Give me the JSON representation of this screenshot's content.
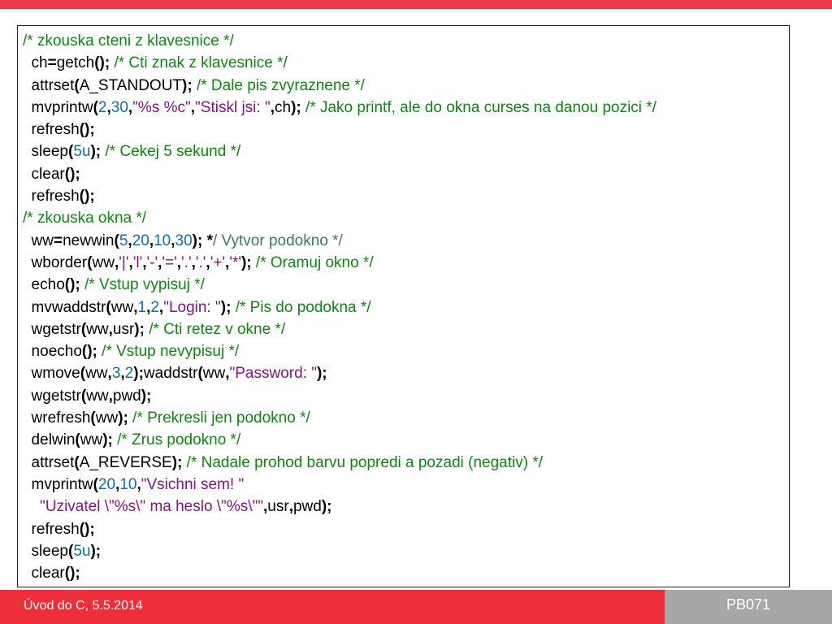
{
  "slide": {
    "footer_left": "Úvod do C, 5.5.2014",
    "footer_right": "PB071"
  },
  "code_lines": [
    [
      [
        "cm",
        "/* zkouska cteni z klavesnice */"
      ]
    ],
    [
      [
        "tx",
        "  ch"
      ],
      [
        "kw",
        "="
      ],
      [
        "tx",
        "getch"
      ],
      [
        "kw",
        "();"
      ],
      [
        "tx",
        " "
      ],
      [
        "cm",
        "/* Cti znak z klavesnice */"
      ]
    ],
    [
      [
        "tx",
        "  attrset"
      ],
      [
        "kw",
        "("
      ],
      [
        "tx",
        "A_STANDOUT"
      ],
      [
        "kw",
        ");"
      ],
      [
        "tx",
        " "
      ],
      [
        "cm",
        "/* Dale pis zvyraznene */"
      ]
    ],
    [
      [
        "tx",
        "  mvprintw"
      ],
      [
        "kw",
        "("
      ],
      [
        "nm",
        "2"
      ],
      [
        "kw",
        ","
      ],
      [
        "nm",
        "30"
      ],
      [
        "kw",
        ","
      ],
      [
        "st",
        "\"%s %c\""
      ],
      [
        "kw",
        ","
      ],
      [
        "st",
        "\"Stiskl jsi: \""
      ],
      [
        "kw",
        ","
      ],
      [
        "tx",
        "ch"
      ],
      [
        "kw",
        ");"
      ],
      [
        "tx",
        " "
      ],
      [
        "cm",
        "/* Jako printf, ale do okna curses na danou pozici */"
      ]
    ],
    [
      [
        "tx",
        "  refresh"
      ],
      [
        "kw",
        "();"
      ]
    ],
    [
      [
        "tx",
        "  sleep"
      ],
      [
        "kw",
        "("
      ],
      [
        "nm",
        "5u"
      ],
      [
        "kw",
        ");"
      ],
      [
        "tx",
        " "
      ],
      [
        "cm",
        "/* Cekej 5 sekund */"
      ]
    ],
    [
      [
        "tx",
        "  clear"
      ],
      [
        "kw",
        "();"
      ]
    ],
    [
      [
        "tx",
        "  refresh"
      ],
      [
        "kw",
        "();"
      ]
    ],
    [
      [
        "cm",
        "/* zkouska okna */"
      ]
    ],
    [
      [
        "tx",
        "  ww"
      ],
      [
        "kw",
        "="
      ],
      [
        "tx",
        "newwin"
      ],
      [
        "kw",
        "("
      ],
      [
        "nm",
        "5"
      ],
      [
        "kw",
        ","
      ],
      [
        "nm",
        "20"
      ],
      [
        "kw",
        ","
      ],
      [
        "nm",
        "10"
      ],
      [
        "kw",
        ","
      ],
      [
        "nm",
        "30"
      ],
      [
        "kw",
        ");"
      ],
      [
        "tx",
        " "
      ],
      [
        "kw",
        "*"
      ],
      [
        "cmg",
        "/ Vytvor podokno */"
      ]
    ],
    [
      [
        "tx",
        "  wborder"
      ],
      [
        "kw",
        "("
      ],
      [
        "tx",
        "ww"
      ],
      [
        "kw",
        ","
      ],
      [
        "st",
        "'|'"
      ],
      [
        "kw",
        ","
      ],
      [
        "st",
        "'l'"
      ],
      [
        "kw",
        ","
      ],
      [
        "st",
        "'-'"
      ],
      [
        "kw",
        ","
      ],
      [
        "st",
        "'='"
      ],
      [
        "kw",
        ","
      ],
      [
        "st",
        "'.'"
      ],
      [
        "kw",
        ","
      ],
      [
        "st",
        "'.'"
      ],
      [
        "kw",
        ","
      ],
      [
        "st",
        "'+'"
      ],
      [
        "kw",
        ","
      ],
      [
        "st",
        "'*'"
      ],
      [
        "kw",
        ");"
      ],
      [
        "tx",
        " "
      ],
      [
        "cm",
        "/* Oramuj okno */"
      ]
    ],
    [
      [
        "tx",
        "  echo"
      ],
      [
        "kw",
        "();"
      ],
      [
        "tx",
        " "
      ],
      [
        "cm",
        "/* Vstup vypisuj */"
      ]
    ],
    [
      [
        "tx",
        "  mvwaddstr"
      ],
      [
        "kw",
        "("
      ],
      [
        "tx",
        "ww"
      ],
      [
        "kw",
        ","
      ],
      [
        "nm",
        "1"
      ],
      [
        "kw",
        ","
      ],
      [
        "nm",
        "2"
      ],
      [
        "kw",
        ","
      ],
      [
        "st",
        "\"Login: \""
      ],
      [
        "kw",
        ");"
      ],
      [
        "tx",
        " "
      ],
      [
        "cm",
        "/* Pis do podokna */"
      ]
    ],
    [
      [
        "tx",
        "  wgetstr"
      ],
      [
        "kw",
        "("
      ],
      [
        "tx",
        "ww"
      ],
      [
        "kw",
        ","
      ],
      [
        "tx",
        "usr"
      ],
      [
        "kw",
        ");"
      ],
      [
        "tx",
        " "
      ],
      [
        "cm",
        "/* Cti retez v okne */"
      ]
    ],
    [
      [
        "tx",
        "  noecho"
      ],
      [
        "kw",
        "();"
      ],
      [
        "tx",
        " "
      ],
      [
        "cm",
        "/* Vstup nevypisuj */"
      ]
    ],
    [
      [
        "tx",
        "  wmove"
      ],
      [
        "kw",
        "("
      ],
      [
        "tx",
        "ww"
      ],
      [
        "kw",
        ","
      ],
      [
        "nm",
        "3"
      ],
      [
        "kw",
        ","
      ],
      [
        "nm",
        "2"
      ],
      [
        "kw",
        ");"
      ],
      [
        "tx",
        "waddstr"
      ],
      [
        "kw",
        "("
      ],
      [
        "tx",
        "ww"
      ],
      [
        "kw",
        ","
      ],
      [
        "st",
        "\"Password: \""
      ],
      [
        "kw",
        ");"
      ]
    ],
    [
      [
        "tx",
        "  wgetstr"
      ],
      [
        "kw",
        "("
      ],
      [
        "tx",
        "ww"
      ],
      [
        "kw",
        ","
      ],
      [
        "tx",
        "pwd"
      ],
      [
        "kw",
        ");"
      ]
    ],
    [
      [
        "tx",
        "  wrefresh"
      ],
      [
        "kw",
        "("
      ],
      [
        "tx",
        "ww"
      ],
      [
        "kw",
        ");"
      ],
      [
        "tx",
        " "
      ],
      [
        "cm",
        "/* Prekresli jen podokno */"
      ]
    ],
    [
      [
        "tx",
        "  delwin"
      ],
      [
        "kw",
        "("
      ],
      [
        "tx",
        "ww"
      ],
      [
        "kw",
        ");"
      ],
      [
        "tx",
        " "
      ],
      [
        "cm",
        "/* Zrus podokno */"
      ]
    ],
    [
      [
        "tx",
        "  attrset"
      ],
      [
        "kw",
        "("
      ],
      [
        "tx",
        "A_REVERSE"
      ],
      [
        "kw",
        ");"
      ],
      [
        "tx",
        " "
      ],
      [
        "cm",
        "/* Nadale prohod barvu popredi a pozadi (negativ) */"
      ]
    ],
    [
      [
        "tx",
        "  mvprintw"
      ],
      [
        "kw",
        "("
      ],
      [
        "nm",
        "20"
      ],
      [
        "kw",
        ","
      ],
      [
        "nm",
        "10"
      ],
      [
        "kw",
        ","
      ],
      [
        "st",
        "\"Vsichni sem! \""
      ]
    ],
    [
      [
        "tx",
        "    "
      ],
      [
        "st",
        "\"Uzivatel \\\"%s\\\" ma heslo \\\"%s\\\"\""
      ],
      [
        "kw",
        ","
      ],
      [
        "tx",
        "usr"
      ],
      [
        "kw",
        ","
      ],
      [
        "tx",
        "pwd"
      ],
      [
        "kw",
        ");"
      ]
    ],
    [
      [
        "tx",
        "  refresh"
      ],
      [
        "kw",
        "();"
      ]
    ],
    [
      [
        "tx",
        "  sleep"
      ],
      [
        "kw",
        "("
      ],
      [
        "nm",
        "5u"
      ],
      [
        "kw",
        ");"
      ]
    ],
    [
      [
        "tx",
        "  clear"
      ],
      [
        "kw",
        "();"
      ]
    ]
  ],
  "colors": {
    "accent_red": "#ee2e38",
    "footer_grey": "#a7a7a7",
    "comment": "#0a8a0a",
    "number": "#0b6fa8",
    "string": "#8a108a"
  }
}
